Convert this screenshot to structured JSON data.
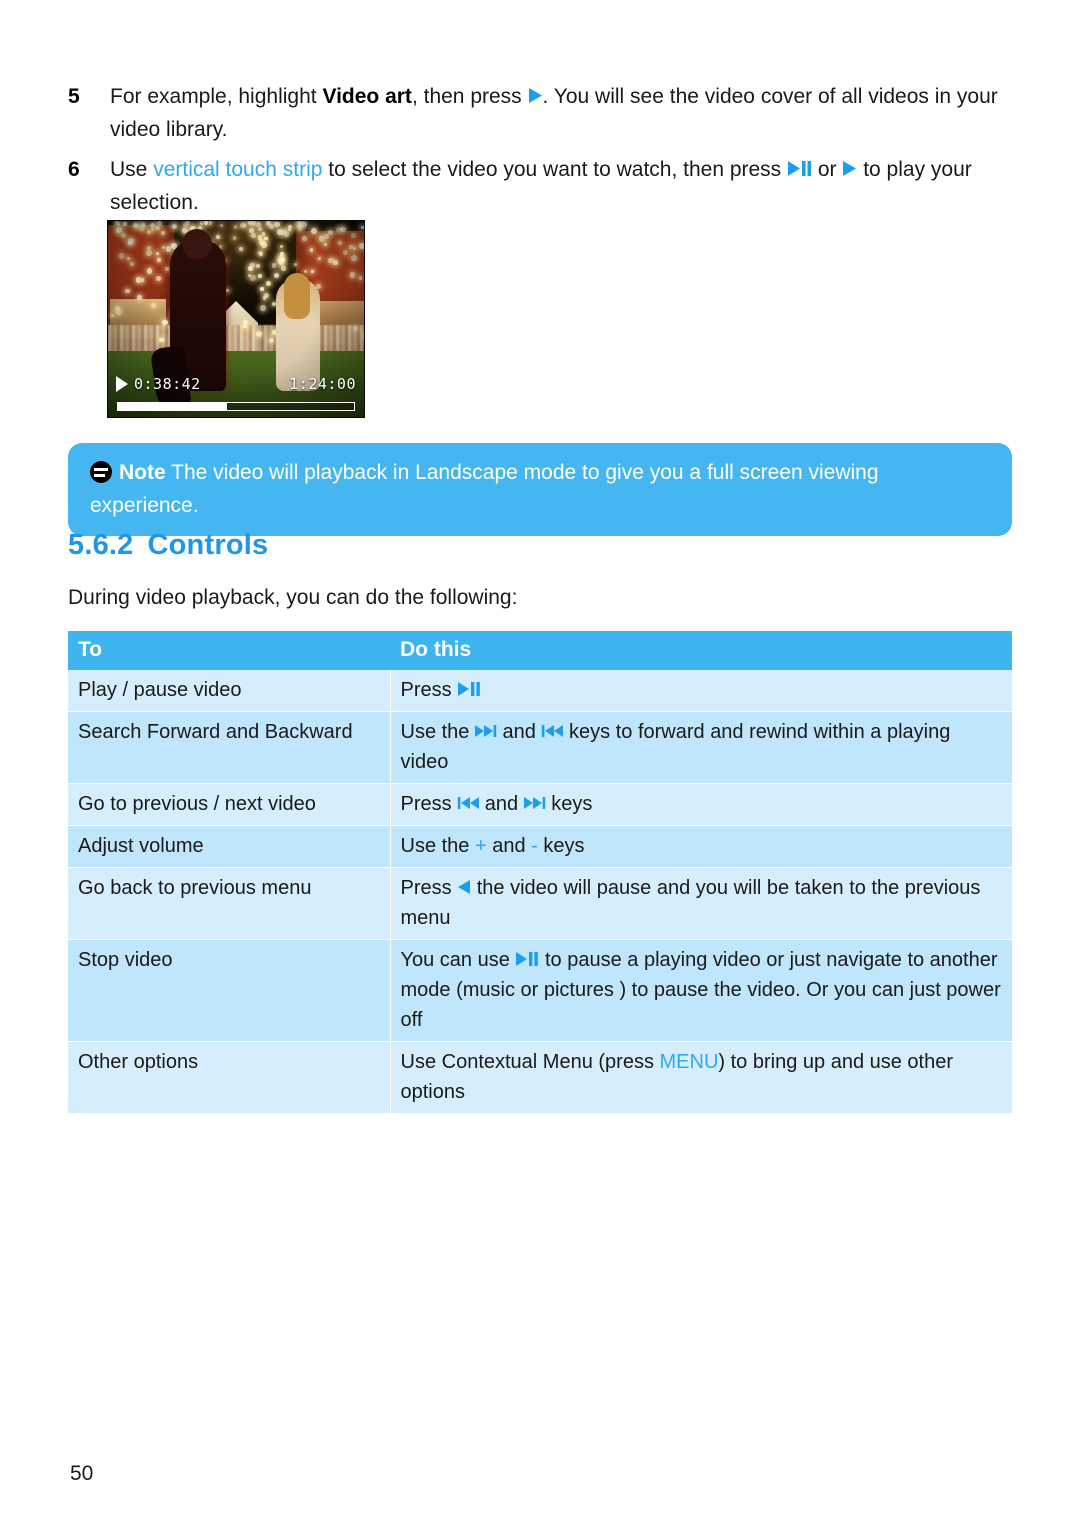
{
  "steps": [
    {
      "number": "5",
      "text_parts": [
        {
          "t": "For example, highlight ",
          "style": "plain"
        },
        {
          "t": "Video art",
          "style": "bold"
        },
        {
          "t": ", then press ",
          "style": "plain"
        },
        {
          "t": "play-icon",
          "style": "icon"
        },
        {
          "t": ". You will see the video cover of all videos in your video library.",
          "style": "plain"
        }
      ]
    },
    {
      "number": "6",
      "text_parts": [
        {
          "t": "Use ",
          "style": "plain"
        },
        {
          "t": "vertical touch strip",
          "style": "accent"
        },
        {
          "t": " to select the video you want to watch, then press ",
          "style": "plain"
        },
        {
          "t": "play-pause-icon",
          "style": "icon"
        },
        {
          "t": " or ",
          "style": "plain"
        },
        {
          "t": "play-icon",
          "style": "icon"
        },
        {
          "t": " to play your selection.",
          "style": "plain"
        }
      ]
    }
  ],
  "step5": {
    "number": "5",
    "pre": "For example, highlight ",
    "bold": "Video art",
    "mid": ", then press ",
    "post": ". You will see the video cover of all videos in your video library."
  },
  "step6": {
    "number": "6",
    "pre": "Use ",
    "accent": "vertical touch strip",
    "mid": " to select the video you want to watch, then press ",
    "mid2": " or ",
    "post": " to play your selection."
  },
  "screenshot": {
    "elapsed_time": "0:38:42",
    "total_time": "1:24:00",
    "progress_percent": 46,
    "play_icon": "play-icon",
    "scene_description": "night carnival with string lights"
  },
  "note": {
    "icon": "note-icon",
    "label": "Note",
    "body": " The video will playback in Landscape mode to give you a full screen viewing experience."
  },
  "heading": {
    "number": "5.6.2",
    "title": "Controls"
  },
  "intro": "During video playback, you can do the following:",
  "table": {
    "headers": [
      "To",
      "Do this"
    ],
    "rows": [
      {
        "to": "Play / pause video",
        "do_parts": [
          {
            "t": "Press ",
            "style": "plain"
          },
          {
            "t": "play-pause-icon",
            "style": "icon"
          }
        ]
      },
      {
        "to": "Search Forward and Backward",
        "do_parts": [
          {
            "t": "Use the ",
            "style": "plain"
          },
          {
            "t": "fast-forward-icon",
            "style": "icon"
          },
          {
            "t": " and ",
            "style": "plain"
          },
          {
            "t": "rewind-icon",
            "style": "icon"
          },
          {
            "t": " keys to forward and rewind within a playing video",
            "style": "plain"
          }
        ]
      },
      {
        "to": "Go to previous / next video",
        "do_parts": [
          {
            "t": "Press ",
            "style": "plain"
          },
          {
            "t": "rewind-icon",
            "style": "icon"
          },
          {
            "t": " and ",
            "style": "plain"
          },
          {
            "t": "fast-forward-icon",
            "style": "icon"
          },
          {
            "t": " keys",
            "style": "plain"
          }
        ]
      },
      {
        "to": "Adjust volume",
        "do_parts": [
          {
            "t": "Use the ",
            "style": "plain"
          },
          {
            "t": "+",
            "style": "accent"
          },
          {
            "t": " and ",
            "style": "plain"
          },
          {
            "t": "-",
            "style": "accent"
          },
          {
            "t": " keys",
            "style": "plain"
          }
        ]
      },
      {
        "to": "Go back to previous menu",
        "do_parts": [
          {
            "t": "Press ",
            "style": "plain"
          },
          {
            "t": "back-icon",
            "style": "icon"
          },
          {
            "t": " the video will pause and you will be taken to the previous menu",
            "style": "plain"
          }
        ]
      },
      {
        "to": "Stop video",
        "do_parts": [
          {
            "t": "You can use ",
            "style": "plain"
          },
          {
            "t": "play-pause-icon",
            "style": "icon"
          },
          {
            "t": " to pause a playing video or just navigate to another mode (music or pictures ) to pause the video. Or you can just power off",
            "style": "plain"
          }
        ]
      },
      {
        "to": "Other options",
        "do_parts": [
          {
            "t": "Use Contextual Menu (press ",
            "style": "plain"
          },
          {
            "t": "MENU",
            "style": "accent"
          },
          {
            "t": ") to bring up and use other options",
            "style": "plain"
          }
        ]
      }
    ]
  },
  "page_number": "50",
  "colors": {
    "accent_blue": "#2eaaf0",
    "heading_blue": "#2196e8",
    "note_bg": "#45b6ef",
    "table_header_bg": "#3eb4ef",
    "row_light": "#d6eefc",
    "row_dark": "#bfe6fa",
    "text": "#1a1a1a"
  }
}
